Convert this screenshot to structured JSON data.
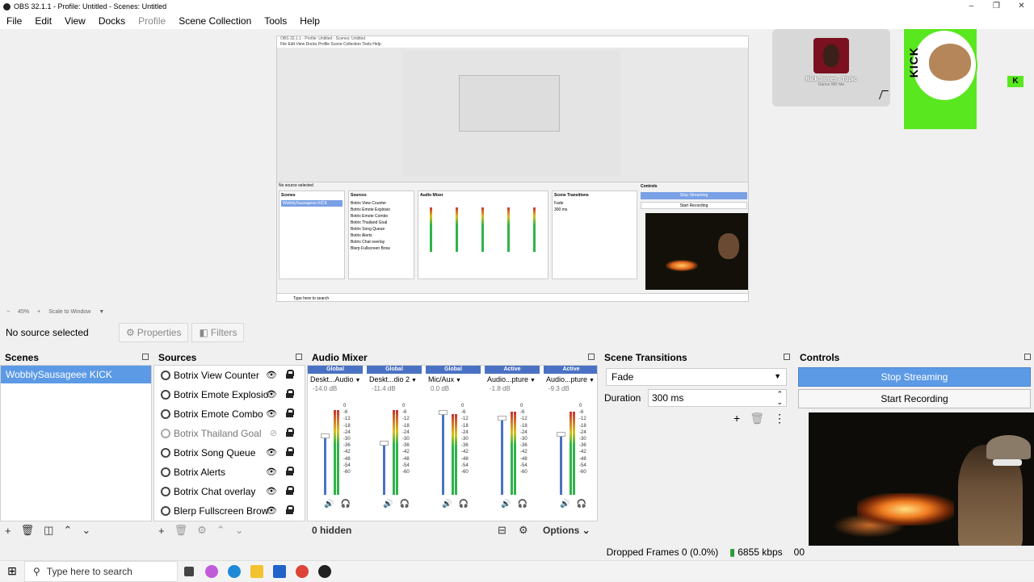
{
  "window": {
    "title": "OBS 32.1.1 - Profile: Untitled - Scenes: Untitled",
    "controls": [
      "–",
      "❐",
      "✕"
    ]
  },
  "menu": {
    "items": [
      "File",
      "Edit",
      "View",
      "Docks",
      "Profile",
      "Scene Collection",
      "Tools",
      "Help"
    ]
  },
  "nested_preview": {
    "title": "OBS 32.1.1 - Profile: Untitled - Scenes: Untitled",
    "menu": "File  Edit  View  Docks  Profile  Scene Collection  Tools  Help",
    "no_source": "No source selected",
    "scenes_head": "Scenes",
    "scene": "WobblySausageee KICK",
    "sources_head": "Sources",
    "sources": [
      "Botrix View Counter",
      "Botrix Emote Explosio",
      "Botrix Emote Combo",
      "Botrix Thailand Goal",
      "Botrix Song Queue",
      "Botrix Alerts",
      "Botrix Chat overlay",
      "Blerp Fullscreen Brow"
    ],
    "mixer_head": "Audio Mixer",
    "transitions_head": "Scene Transitions",
    "controls_head": "Controls",
    "stop_streaming": "Stop Streaming",
    "start_recording": "Start Recording",
    "transition": "Fade",
    "duration": "300 ms",
    "taskbar_search": "Type here to search"
  },
  "music_widget": {
    "track": "Rick James - Topic",
    "artist": "Dance Wit' Me"
  },
  "kick": {
    "logo_text": "KICK",
    "small_logo": "K",
    "accent": "#59e71f"
  },
  "zoom": {
    "level": "45%",
    "mode": "Scale to Window"
  },
  "source_toolbar": {
    "no_source": "No source selected",
    "properties": "Properties",
    "filters": "Filters"
  },
  "scenes": {
    "title": "Scenes",
    "items": [
      {
        "label": "WobblySausageee KICK",
        "selected": true
      }
    ]
  },
  "sources": {
    "title": "Sources",
    "items": [
      {
        "label": "Botrix View Counter",
        "visible": true
      },
      {
        "label": "Botrix Emote Explosio",
        "visible": true
      },
      {
        "label": "Botrix Emote Combo",
        "visible": true
      },
      {
        "label": "Botrix Thailand Goal",
        "visible": false
      },
      {
        "label": "Botrix Song Queue",
        "visible": true
      },
      {
        "label": "Botrix Alerts",
        "visible": true
      },
      {
        "label": "Botrix Chat overlay",
        "visible": true
      },
      {
        "label": "Blerp Fullscreen Brow",
        "visible": true
      }
    ]
  },
  "audio_mixer": {
    "title": "Audio Mixer",
    "hidden_count": "0 hidden",
    "options": "Options",
    "channels": [
      {
        "tag": "Global",
        "name": "Deskt...Audio",
        "db": "-14.0 dB",
        "level": 0.66,
        "meter": 0.92
      },
      {
        "tag": "Global",
        "name": "Deskt...dio 2",
        "db": "-11.4 dB",
        "level": 0.58,
        "meter": 0.92
      },
      {
        "tag": "Global",
        "name": "Mic/Aux",
        "db": "0.0 dB",
        "level": 0.93,
        "meter": 0.88
      },
      {
        "tag": "Active",
        "name": "Audio...pture",
        "db": "-1.8 dB",
        "level": 0.86,
        "meter": 0.9
      },
      {
        "tag": "Active",
        "name": "Audio...pture",
        "db": "-9.3 dB",
        "level": 0.68,
        "meter": 0.9
      }
    ],
    "scale": [
      "0",
      "-6",
      "-12",
      "-18",
      "-24",
      "-30",
      "-36",
      "-42",
      "-48",
      "-54",
      "-60"
    ]
  },
  "scene_transitions": {
    "title": "Scene Transitions",
    "transition": "Fade",
    "duration_label": "Duration",
    "duration_value": "300 ms"
  },
  "controls": {
    "title": "Controls",
    "stop_streaming": "Stop Streaming",
    "start_recording": "Start Recording"
  },
  "status": {
    "dropped_frames": "Dropped Frames 0 (0.0%)",
    "bitrate": "6855 kbps",
    "extra": "00"
  },
  "taskbar": {
    "search_placeholder": "Type here to search",
    "apps": [
      {
        "name": "task-view",
        "color": "#444444"
      },
      {
        "name": "copilot",
        "color": "#c05cd8"
      },
      {
        "name": "edge",
        "color": "#1d8ad8"
      },
      {
        "name": "file-explorer",
        "color": "#f2c231"
      },
      {
        "name": "store",
        "color": "#2263c9"
      },
      {
        "name": "chrome",
        "color": "#db4437"
      },
      {
        "name": "obs",
        "color": "#202020"
      }
    ]
  }
}
